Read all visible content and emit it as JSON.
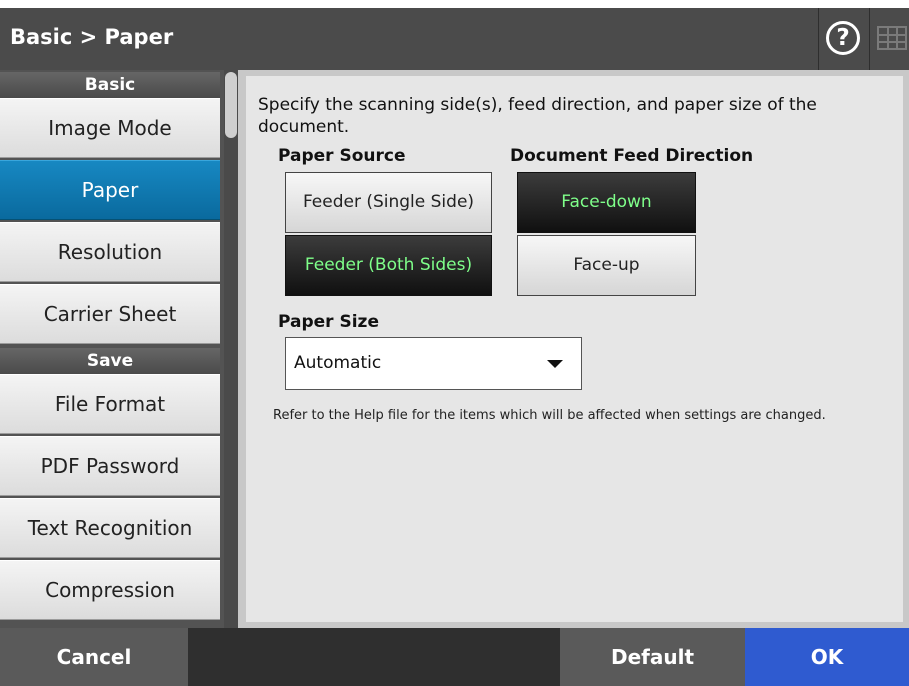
{
  "header": {
    "title": "Basic > Paper",
    "help_label": "?"
  },
  "sidebar": {
    "sections": [
      {
        "label": "Basic"
      },
      {
        "label": "Save"
      }
    ],
    "items": [
      {
        "label": "Image Mode",
        "selected": false
      },
      {
        "label": "Paper",
        "selected": true
      },
      {
        "label": "Resolution",
        "selected": false
      },
      {
        "label": "Carrier Sheet",
        "selected": false
      },
      {
        "label": "File Format",
        "selected": false
      },
      {
        "label": "PDF Password",
        "selected": false
      },
      {
        "label": "Text Recognition",
        "selected": false
      },
      {
        "label": "Compression",
        "selected": false
      }
    ]
  },
  "main": {
    "instruction": "Specify the scanning side(s), feed direction, and paper size of the document.",
    "paper_source": {
      "label": "Paper Source",
      "options": [
        {
          "label": "Feeder (Single Side)",
          "selected": false
        },
        {
          "label": "Feeder (Both Sides)",
          "selected": true
        }
      ]
    },
    "feed_direction": {
      "label": "Document Feed Direction",
      "options": [
        {
          "label": "Face-down",
          "selected": true
        },
        {
          "label": "Face-up",
          "selected": false
        }
      ]
    },
    "paper_size": {
      "label": "Paper Size",
      "value": "Automatic"
    },
    "note": "Refer to the Help file for the items which will be affected when settings are changed."
  },
  "footer": {
    "cancel_label": "Cancel",
    "default_label": "Default",
    "ok_label": "OK"
  },
  "colors": {
    "selected_tab": "#0a6a9e",
    "ok_button": "#2f5bd0",
    "active_option_text": "#7fff8a"
  }
}
